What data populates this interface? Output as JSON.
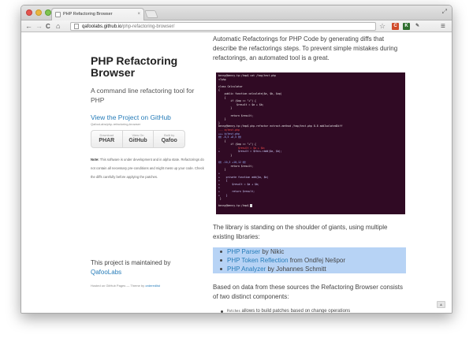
{
  "browser": {
    "tab_title": "PHP Refactoring Browser",
    "tab_close": "×",
    "url_host": "qafoolabs.github.io",
    "url_path": "/php-refactoring-browser/",
    "back_icon": "←",
    "forward_icon": "→",
    "reload_icon": "C",
    "home_icon": "⌂",
    "star_icon": "☆",
    "fullscreen_icon": "⤢",
    "menu_icon": "≡",
    "extensions": [
      {
        "name": "ext-1",
        "label": "C",
        "color": "#d04a2a"
      },
      {
        "name": "ext-2",
        "label": "K",
        "color": "#2e6e2e"
      },
      {
        "name": "wrench",
        "label": "🔧",
        "color": "#777777"
      }
    ]
  },
  "sidebar": {
    "title": "PHP Refactoring Browser",
    "description": "A command line refactoring tool for PHP",
    "github_link": "View the Project on GitHub",
    "github_sub": "QafooLabs/php-refactoring-browser",
    "downloads": [
      {
        "small": "Download",
        "big": "PHAR"
      },
      {
        "small": "View On",
        "big": "GitHub"
      },
      {
        "small": "Built by",
        "big": "Qafoo"
      }
    ],
    "note_label": "Note:",
    "note_text": "This software is under development and in alpha state. Refactorings do not contain all necessary pre-conditions and might mess up your code. Check the diffs carefully before applying the patches.",
    "maintained_text": "This project is maintained by",
    "maintainer": "QafooLabs",
    "hosted_prefix": "Hosted on GitHub Pages — Theme by",
    "theme_author": "orderedlist"
  },
  "main": {
    "intro": "Automatic Refactorings for PHP Code by generating diffs that describe the refactorings steps. To prevent simple mistakes during refactorings, an automated tool is a great.",
    "terminal_lines": [
      {
        "text": "benny@benny-tp:/tmp$ cat /tmp/test.php",
        "kind": "prompt"
      },
      {
        "text": "<?php",
        "kind": "normal"
      },
      {
        "text": "",
        "kind": "normal"
      },
      {
        "text": "class Calculator",
        "kind": "normal"
      },
      {
        "text": "{",
        "kind": "normal"
      },
      {
        "text": "    public function calculate($a, $b, $op)",
        "kind": "normal"
      },
      {
        "text": "    {",
        "kind": "normal"
      },
      {
        "text": "        if ($op == \"+\") {",
        "kind": "normal"
      },
      {
        "text": "            $result = $a + $b;",
        "kind": "normal"
      },
      {
        "text": "        }",
        "kind": "normal"
      },
      {
        "text": "",
        "kind": "normal"
      },
      {
        "text": "        return $result;",
        "kind": "normal"
      },
      {
        "text": "    }",
        "kind": "normal"
      },
      {
        "text": "}",
        "kind": "normal"
      },
      {
        "text": "benny@benny-tp:/tmp$ php-refactor extract-method /tmp/test.php 8-8 addIsolatedDiff",
        "kind": "prompt"
      },
      {
        "text": "--- a/test.php",
        "kind": "del"
      },
      {
        "text": "+++ b/test.php",
        "kind": "hunk"
      },
      {
        "text": "@@ -8,5 +8,5 @@",
        "kind": "hunk"
      },
      {
        "text": "    {",
        "kind": "normal"
      },
      {
        "text": "        if ($op == \"+\") {",
        "kind": "normal"
      },
      {
        "text": "-            $result = $a + $b;",
        "kind": "del"
      },
      {
        "text": "+            $result = $this->add($a, $b);",
        "kind": "add"
      },
      {
        "text": "        }",
        "kind": "normal"
      },
      {
        "text": "",
        "kind": "normal"
      },
      {
        "text": "@@ -10,3 +10,12 @@",
        "kind": "hunk"
      },
      {
        "text": "        return $result;",
        "kind": "normal"
      },
      {
        "text": "    }",
        "kind": "normal"
      },
      {
        "text": "+",
        "kind": "add"
      },
      {
        "text": "+    private function add($a, $b)",
        "kind": "add"
      },
      {
        "text": "+    {",
        "kind": "add"
      },
      {
        "text": "+        $result = $a + $b;",
        "kind": "add"
      },
      {
        "text": "+",
        "kind": "add"
      },
      {
        "text": "+        return $result;",
        "kind": "add"
      },
      {
        "text": "+    }",
        "kind": "add"
      },
      {
        "text": " }",
        "kind": "normal"
      },
      {
        "text": "",
        "kind": "normal"
      },
      {
        "text": "benny@benny-tp:/tmp$ ",
        "kind": "prompt"
      }
    ],
    "libs_intro": "The library is standing on the shoulder of giants, using multiple existing libraries:",
    "libs": [
      {
        "link": "PHP Parser",
        "suffix": " by Nikic"
      },
      {
        "link": "PHP Token Reflection",
        "suffix": " from Ondřej Nešpor"
      },
      {
        "link": "PHP Analyzer",
        "suffix": " by Johannes Schmitt"
      }
    ],
    "based_on": "Based on data from these sources the Refactoring Browser consists of two distinct components:",
    "component_code": "Patches",
    "component_text": " allows to build patches based on change operations",
    "scroll_top": "▲"
  }
}
